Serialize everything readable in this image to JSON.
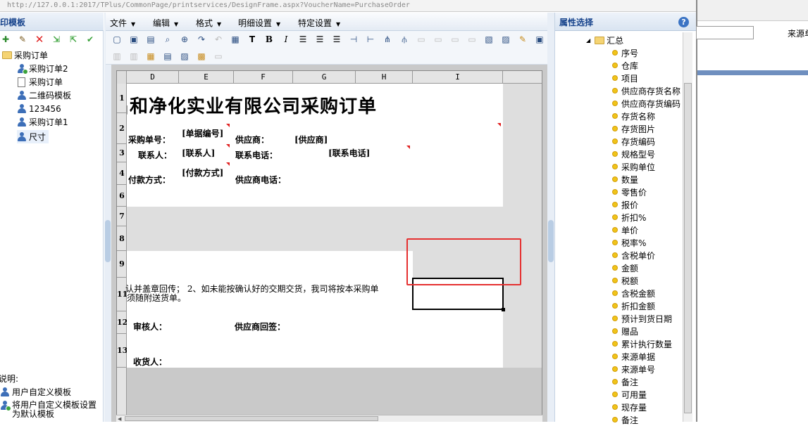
{
  "url": "http://127.0.0.1:2017/TPlus/CommonPage/printservices/DesignFrame.aspx?VoucherName=PurchaseOrder",
  "left_panel": {
    "title": "打印模板",
    "tree_root": "采购订单",
    "tree_items": [
      "采购订单2",
      "采购订单",
      "二维码模板",
      "123456",
      "采购订单1",
      "尺寸"
    ],
    "legend_title": "说明:",
    "legend_items": [
      "用户自定义模板",
      "将用户自定义模板设置为默认模板"
    ]
  },
  "menubar": {
    "items": [
      "文件",
      "编辑",
      "格式",
      "明细设置",
      "特定设置"
    ]
  },
  "sheet": {
    "columns": [
      "D",
      "E",
      "F",
      "G",
      "H",
      "I"
    ],
    "rows": [
      "1",
      "2",
      "3",
      "4",
      "6",
      "7",
      "8",
      "9",
      "11",
      "12",
      "13"
    ],
    "title": "昌和净化实业有限公司采购订单",
    "fields": {
      "order_no_label": "采购单号：",
      "order_no_value": "[单据编号]",
      "supplier_label": "供应商：",
      "supplier_value": "[供应商]",
      "contact_label": "联系人：",
      "contact_value": "[联系人]",
      "phone_label": "联系电话：",
      "phone_value": "[联系电话]",
      "payment_label": "付款方式：",
      "payment_value": "[付款方式]",
      "supplier_phone_label": "供应商电话：",
      "reviewer_label": "审核人：",
      "supplier_reply_label": "供应商回签：",
      "receiver_label": "收货人："
    },
    "note_line1": "认并盖章回传；     2、如未能按确认好的交期交货，我司将按本采购单",
    "note_line2": "须随附送货单。"
  },
  "right_panel": {
    "title": "属性选择",
    "help": "?",
    "group": "汇总",
    "items": [
      "序号",
      "仓库",
      "项目",
      "供应商存货名称",
      "供应商存货编码",
      "存货名称",
      "存货图片",
      "存货编码",
      "规格型号",
      "采购单位",
      "数量",
      "零售价",
      "报价",
      "折扣%",
      "单价",
      "税率%",
      "含税单价",
      "金额",
      "税额",
      "含税金额",
      "折扣金额",
      "预计到货日期",
      "赠品",
      "累计执行数量",
      "来源单据",
      "来源单号",
      "备注",
      "可用量",
      "现存量",
      "备注"
    ]
  },
  "far_right": {
    "label": "来源单"
  },
  "colors": {
    "panel_title": "#15428b",
    "highlight_box": "#e53030",
    "bullet": "#f0c419",
    "folder": "#f5d474"
  }
}
